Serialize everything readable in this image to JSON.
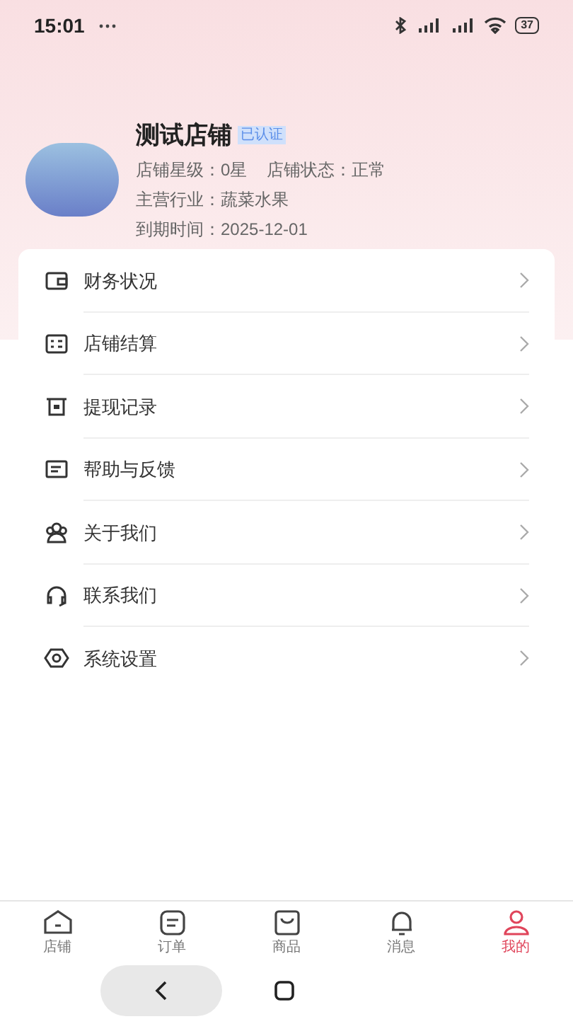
{
  "status_bar": {
    "time": "15:01",
    "battery": "37"
  },
  "profile": {
    "name": "测试店铺",
    "badge": "已认证",
    "rating": "店铺星级：0星",
    "shop_status": "店铺状态：正常",
    "industry": "主营行业：蔬菜水果",
    "expiry": "到期时间：2025-12-01"
  },
  "menu": [
    {
      "kind": "wallet",
      "label": "财务状况"
    },
    {
      "kind": "settlement",
      "label": "店铺结算"
    },
    {
      "kind": "withdraw",
      "label": "提现记录"
    },
    {
      "kind": "feedback",
      "label": "帮助与反馈"
    },
    {
      "kind": "about",
      "label": "关于我们"
    },
    {
      "kind": "contact",
      "label": "联系我们"
    },
    {
      "kind": "settings",
      "label": "系统设置"
    }
  ],
  "tab_bar": [
    {
      "kind": "shop",
      "label": "店铺",
      "selected": false
    },
    {
      "kind": "orders",
      "label": "订单",
      "selected": false
    },
    {
      "kind": "goods",
      "label": "商品",
      "selected": false
    },
    {
      "kind": "messages",
      "label": "消息",
      "selected": false
    },
    {
      "kind": "mine",
      "label": "我的",
      "selected": true
    }
  ]
}
